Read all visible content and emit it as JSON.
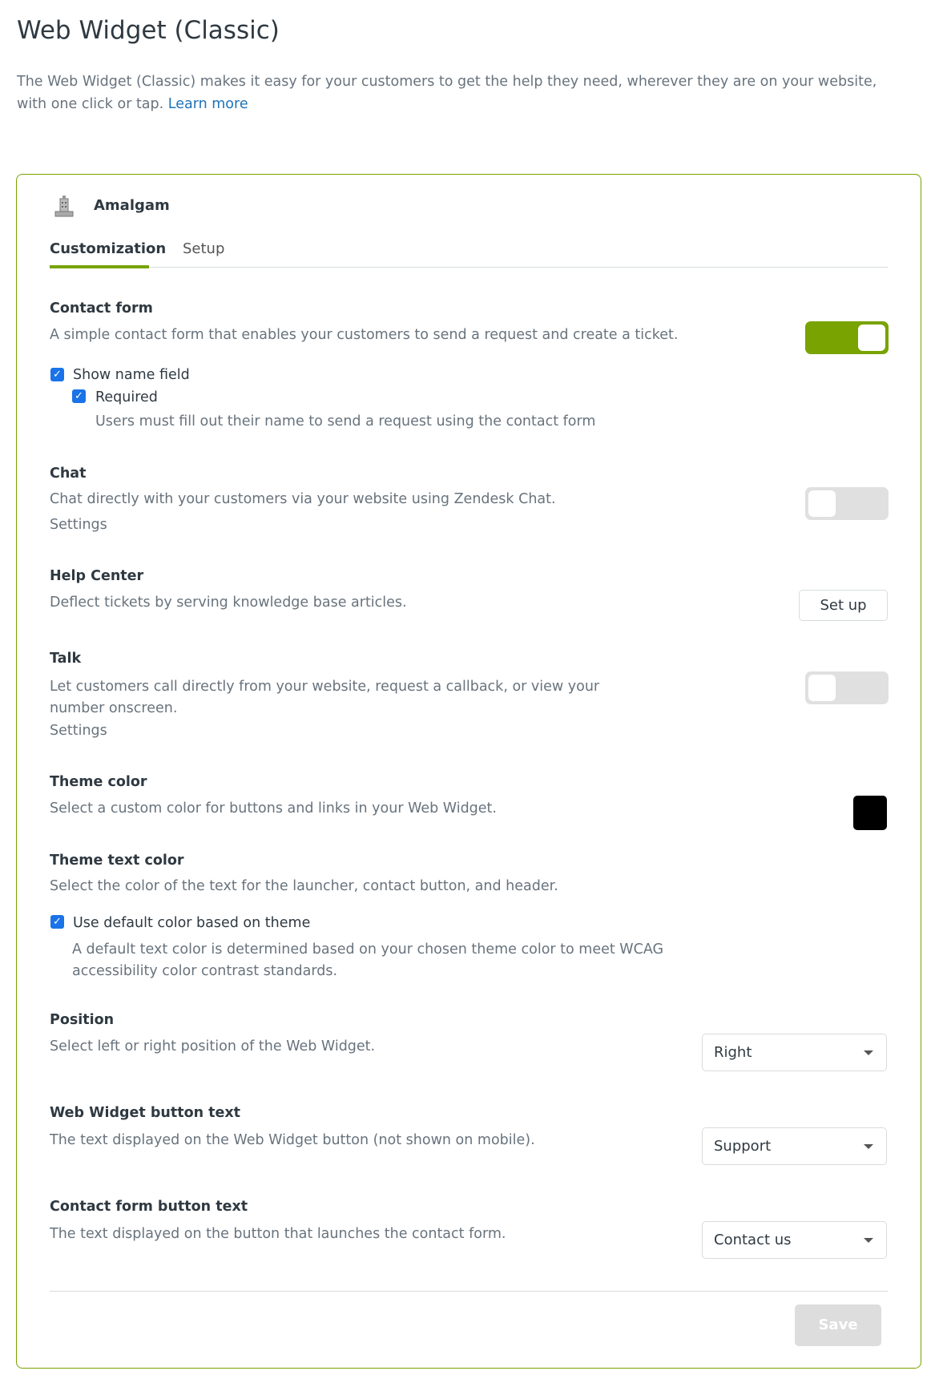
{
  "page": {
    "title": "Web Widget (Classic)",
    "intro": "The Web Widget (Classic) makes it easy for your customers to get the help they need, wherever they are on your website, with one click or tap. ",
    "learn_more": "Learn more"
  },
  "brand": {
    "name": "Amalgam",
    "icon": "building-icon"
  },
  "tabs": [
    {
      "label": "Customization",
      "active": true
    },
    {
      "label": "Setup",
      "active": false
    }
  ],
  "colors": {
    "accent": "#78a300",
    "link": "#1f73b7",
    "theme_color": "#000000"
  },
  "contact_form": {
    "title": "Contact form",
    "desc": "A simple contact form that enables your customers to send a request and create a ticket.",
    "enabled": true,
    "show_name": {
      "label": "Show name field",
      "checked": true
    },
    "required": {
      "label": "Required",
      "checked": true,
      "desc": "Users must fill out their name to send a request using the contact form"
    }
  },
  "chat": {
    "title": "Chat",
    "desc": "Chat directly with your customers via your website using Zendesk Chat.",
    "settings": "Settings",
    "enabled": false
  },
  "help_center": {
    "title": "Help Center",
    "desc": "Deflect tickets by serving knowledge base articles.",
    "button": "Set up"
  },
  "talk": {
    "title": "Talk",
    "desc": "Let customers call directly from your website, request a callback, or view your number onscreen.",
    "settings": "Settings",
    "enabled": false
  },
  "theme_color": {
    "title": "Theme color",
    "desc": "Select a custom color for buttons and links in your Web Widget."
  },
  "theme_text_color": {
    "title": "Theme text color",
    "desc": "Select the color of the text for the launcher, contact button, and header.",
    "checkbox": {
      "label": "Use default color based on theme",
      "checked": true,
      "desc": "A default text color is determined based on your chosen theme color to meet WCAG accessibility color contrast standards."
    }
  },
  "position": {
    "title": "Position",
    "desc": "Select left or right position of the Web Widget.",
    "value": "Right"
  },
  "button_text": {
    "title": "Web Widget button text",
    "desc": "The text displayed on the Web Widget button (not shown on mobile).",
    "value": "Support"
  },
  "contact_button_text": {
    "title": "Contact form button text",
    "desc": "The text displayed on the button that launches the contact form.",
    "value": "Contact us"
  },
  "save": {
    "label": "Save",
    "disabled": true
  }
}
